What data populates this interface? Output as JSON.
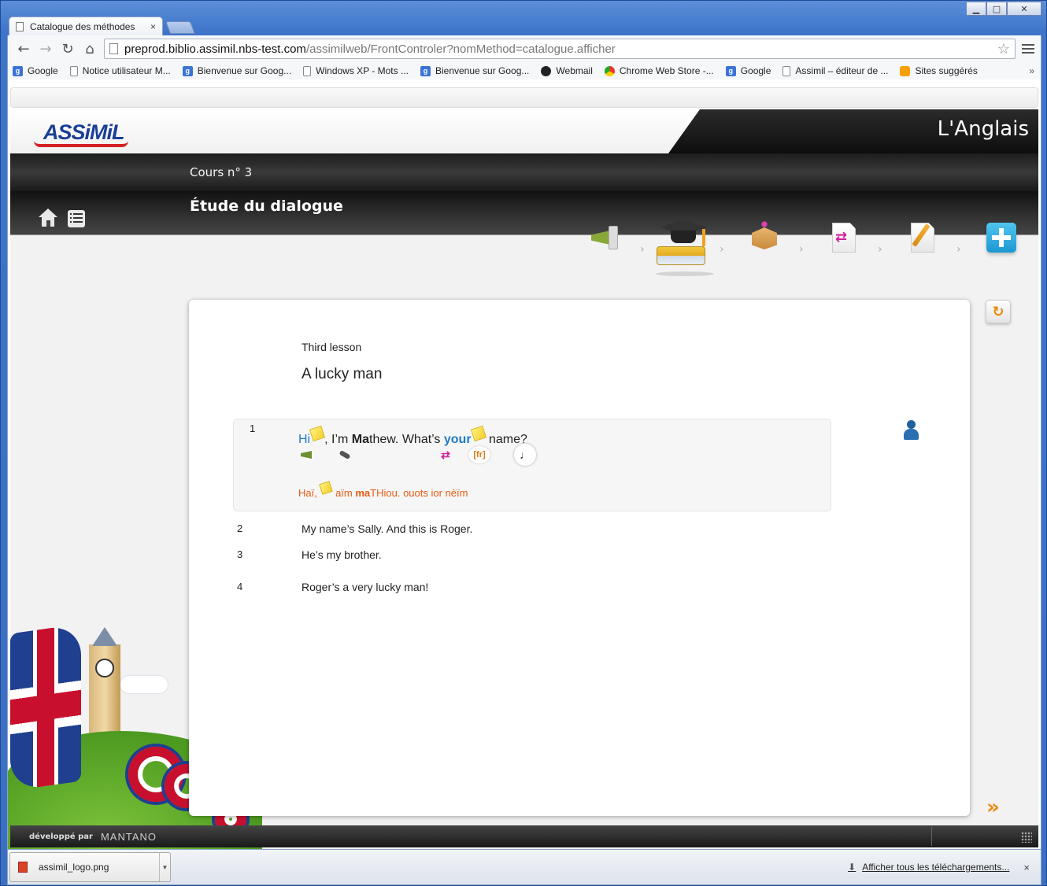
{
  "browser": {
    "tab_title": "Catalogue des méthodes",
    "tab_close": "×",
    "url_host": "preprod.biblio.assimil.nbs-test.com",
    "url_path": "/assimilweb/FrontControler?nomMethod=catalogue.afficher",
    "bookmarks": [
      {
        "label": "Google",
        "icon": "google-icon"
      },
      {
        "label": "Notice utilisateur M...",
        "icon": "page-icon"
      },
      {
        "label": "Bienvenue sur Goog...",
        "icon": "google-icon"
      },
      {
        "label": "Windows XP - Mots ...",
        "icon": "page-icon"
      },
      {
        "label": "Bienvenue sur Goog...",
        "icon": "google-icon"
      },
      {
        "label": "Webmail",
        "icon": "webmail-icon"
      },
      {
        "label": "Chrome Web Store -...",
        "icon": "chrome-store-icon"
      },
      {
        "label": "Google",
        "icon": "google-icon"
      },
      {
        "label": "Assimil – éditeur de ...",
        "icon": "page-icon"
      },
      {
        "label": "Sites suggérés",
        "icon": "suggested-icon"
      }
    ],
    "bookmarks_more": "»"
  },
  "app": {
    "brand": "ASSiMiL",
    "language": "L'Anglais",
    "course": "Cours n° 3",
    "section": "Étude du dialogue",
    "steps": [
      "megaphone-icon",
      "graduation-cap-icon",
      "box-icon",
      "translate-icon",
      "write-icon",
      "plus-icon"
    ],
    "chevron": "›",
    "footer_dev": "développé par",
    "footer_brand": "MANTANO"
  },
  "lesson": {
    "subtitle": "Third lesson",
    "title": "A lucky man",
    "line1": {
      "num": "1",
      "w_hi": "Hi",
      "w_im": ", I’m ",
      "w_ma": "Ma",
      "w_thew": "thew. What’s ",
      "w_your": "your",
      "w_name": " name?",
      "tool_fr": "[fr]",
      "tool_tr": "⇄",
      "tool_music": "♩",
      "ph_hai": "Haï, ",
      "ph_aim": " aïm ",
      "ph_ma": "ma",
      "ph_rest": "THiou. ouots ior nèïm"
    },
    "lines": [
      {
        "num": "2",
        "text": "My name’s Sally. And this is Roger."
      },
      {
        "num": "3",
        "text": "He’s my brother."
      },
      {
        "num": "4",
        "text": "Roger’s a very lucky man!"
      }
    ]
  },
  "downloads": {
    "file": "assimil_logo.png",
    "show_all": "Afficher tous les téléchargements...",
    "close": "×"
  },
  "colors": {
    "accent_blue": "#1d7ac7",
    "phonetic_orange": "#e85a12",
    "nav_orange": "#ef8a10"
  }
}
